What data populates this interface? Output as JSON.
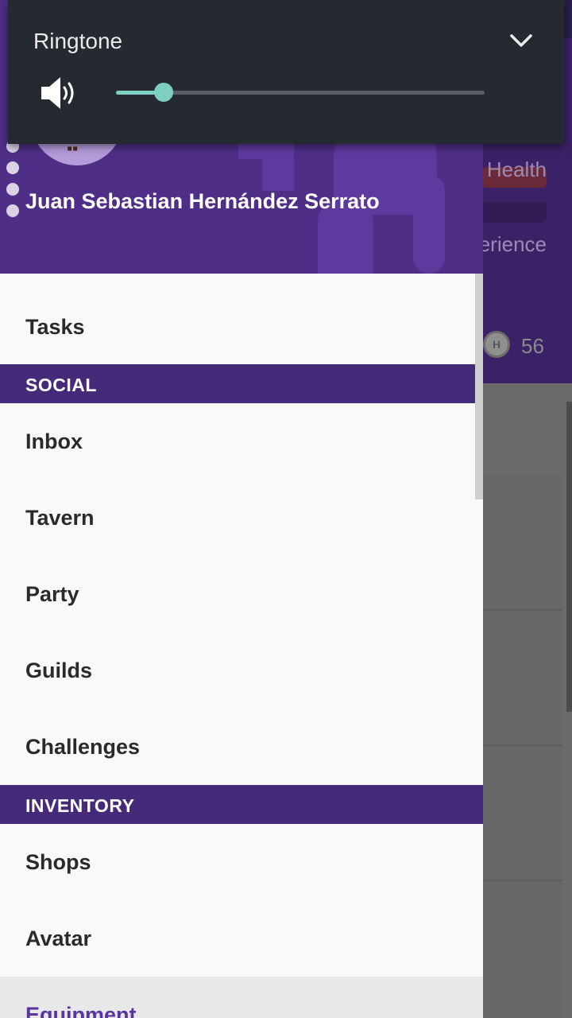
{
  "background": {
    "stats": {
      "health_label": "Health",
      "experience_label": "erience",
      "gem_count": "56",
      "gem_icon_letter": "H"
    }
  },
  "drawer": {
    "user": {
      "name": "Juan Sebastian Hernández Serrato"
    },
    "items": [
      {
        "label": "Tasks"
      }
    ],
    "sections": [
      {
        "title": "SOCIAL",
        "items": [
          {
            "label": "Inbox"
          },
          {
            "label": "Tavern"
          },
          {
            "label": "Party"
          },
          {
            "label": "Guilds"
          },
          {
            "label": "Challenges"
          }
        ]
      },
      {
        "title": "INVENTORY",
        "items": [
          {
            "label": "Shops"
          },
          {
            "label": "Avatar"
          },
          {
            "label": "Equipment"
          }
        ]
      }
    ],
    "selected_item": "Equipment"
  },
  "volume_panel": {
    "label": "Ringtone",
    "level_fraction": 0.13,
    "icons": {
      "speaker": "speaker-volume-icon",
      "collapse": "chevron-down-icon"
    },
    "accent_color": "#7dcfc1"
  },
  "colors": {
    "header_purple": "#4f2e87",
    "section_purple": "#462a7a",
    "selected_text": "#5a34a0",
    "panel_background": "#252a31"
  }
}
